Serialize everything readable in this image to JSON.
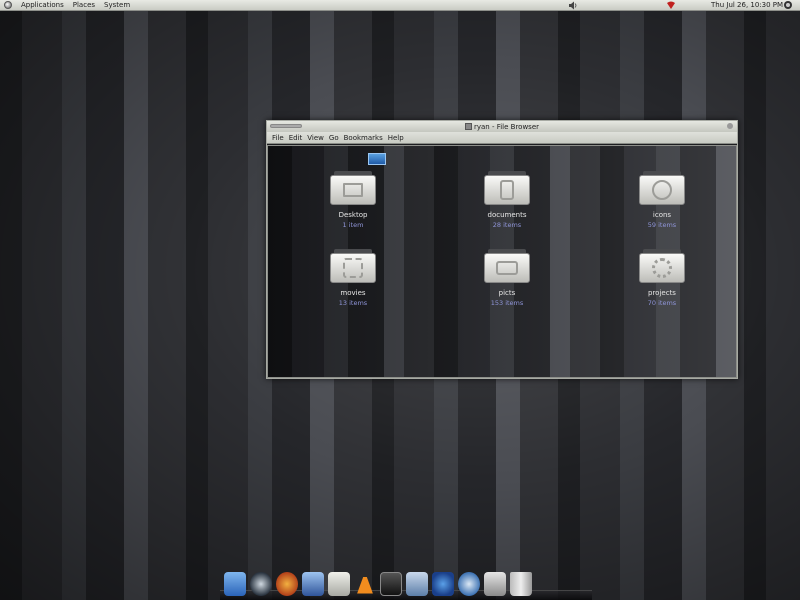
{
  "top_panel": {
    "menus": [
      "Applications",
      "Places",
      "System"
    ],
    "clock": "Thu Jul 26, 10:30 PM"
  },
  "window": {
    "title": "ryan - File Browser",
    "menu": [
      "File",
      "Edit",
      "View",
      "Go",
      "Bookmarks",
      "Help"
    ],
    "folders": [
      {
        "name": "Desktop",
        "count": "1 item",
        "icon": "desktop-folder-icon"
      },
      {
        "name": "documents",
        "count": "28 items",
        "icon": "documents-folder-icon"
      },
      {
        "name": "icons",
        "count": "59 items",
        "icon": "icons-folder-icon"
      },
      {
        "name": "movies",
        "count": "13 items",
        "icon": "movies-folder-icon"
      },
      {
        "name": "picts",
        "count": "153 items",
        "icon": "pictures-folder-icon"
      },
      {
        "name": "projects",
        "count": "70 items",
        "icon": "projects-folder-icon"
      }
    ]
  },
  "dock": {
    "items": [
      "finder-icon",
      "safari-icon",
      "firefox-icon",
      "app-store-icon",
      "calculator-icon",
      "vlc-icon",
      "terminal-icon",
      "preview-icon",
      "mail-icon",
      "network-icon",
      "disk-icon",
      "trash-icon"
    ]
  }
}
